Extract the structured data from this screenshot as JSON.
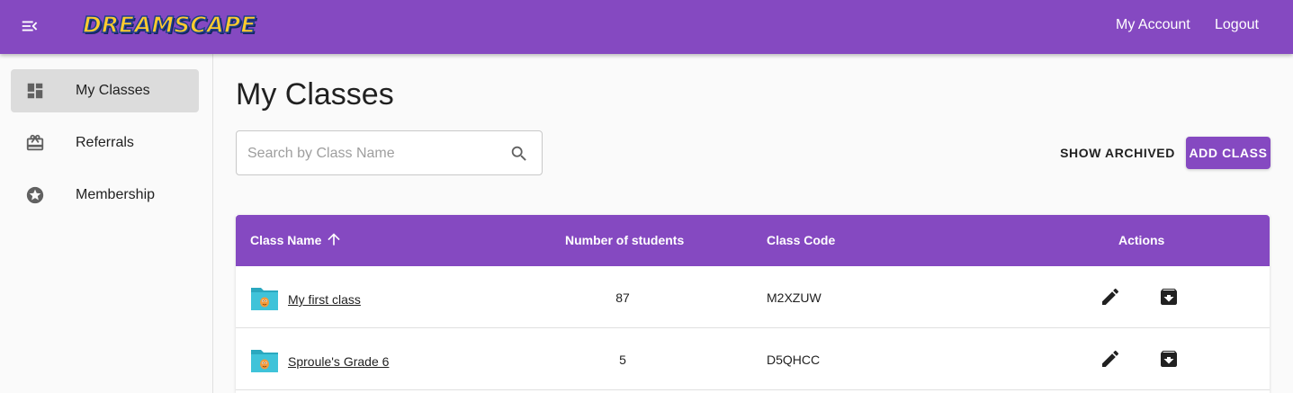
{
  "header": {
    "logo_text": "DREAMSCAPE",
    "my_account": "My Account",
    "logout": "Logout"
  },
  "sidebar": {
    "items": [
      {
        "label": "My Classes",
        "icon": "dashboard-icon",
        "active": true
      },
      {
        "label": "Referrals",
        "icon": "card-giftcard-icon",
        "active": false
      },
      {
        "label": "Membership",
        "icon": "stars-icon",
        "active": false
      }
    ]
  },
  "main": {
    "title": "My Classes",
    "search": {
      "placeholder": "Search by Class Name",
      "value": ""
    },
    "show_archived_label": "SHOW ARCHIVED",
    "add_class_label": "ADD CLASS",
    "table": {
      "columns": [
        "Class Name",
        "Number of students",
        "Class Code",
        "Actions"
      ],
      "sort": "ascending",
      "rows": [
        {
          "name": "My first class",
          "students": "87",
          "code": "M2XZUW"
        },
        {
          "name": "Sproule's Grade 6",
          "students": "5",
          "code": "D5QHCC"
        }
      ]
    }
  },
  "colors": {
    "primary": "#8549c1",
    "folder": "#3fc3d9",
    "text": "#212121"
  }
}
